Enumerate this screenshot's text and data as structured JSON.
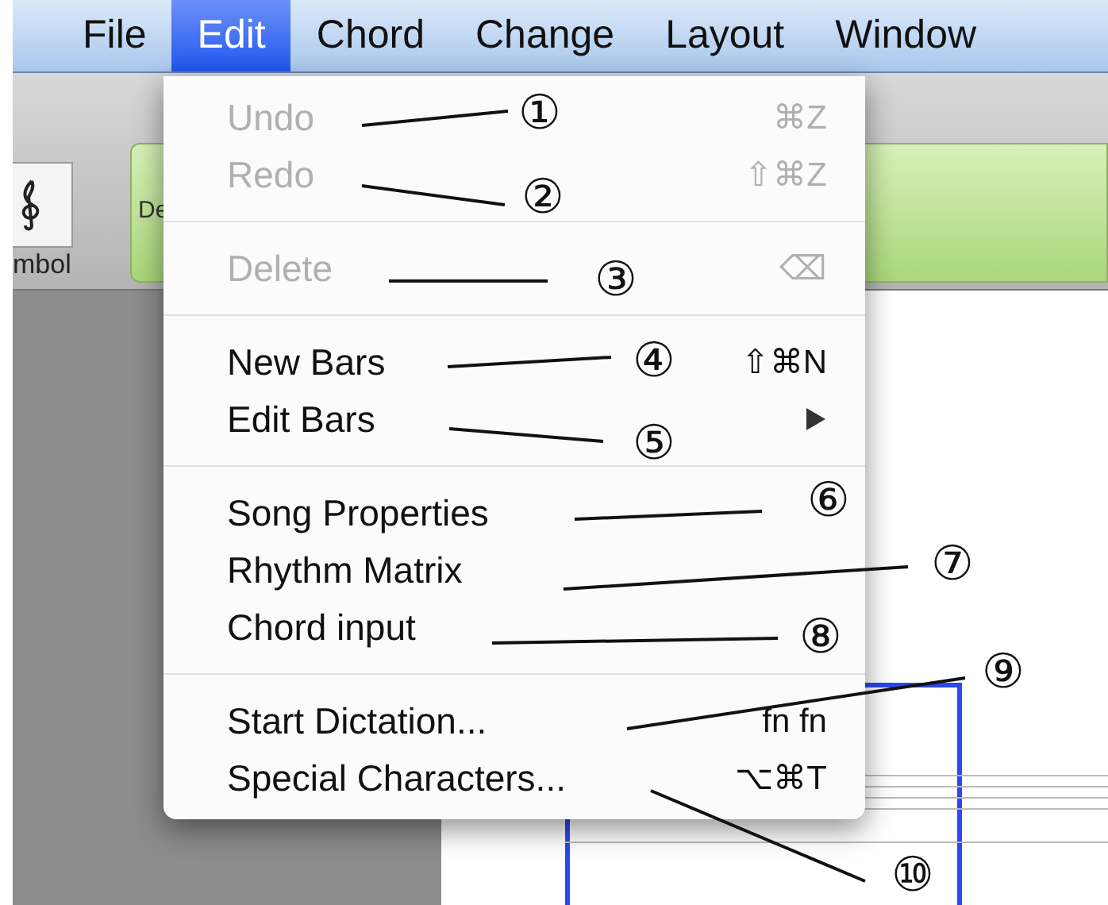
{
  "menu_bar": [
    {
      "label": "File",
      "selected": false
    },
    {
      "label": "Edit",
      "selected": true
    },
    {
      "label": "Chord",
      "selected": false
    },
    {
      "label": "Change",
      "selected": false
    },
    {
      "label": "Layout",
      "selected": false
    },
    {
      "label": "Window",
      "selected": false
    }
  ],
  "toolbar": {
    "symbol_button_label": "mbol",
    "panel_text": "De"
  },
  "menu": [
    {
      "kind": "item",
      "label": "Undo",
      "shortcut": "⌘Z",
      "disabled": true
    },
    {
      "kind": "item",
      "label": "Redo",
      "shortcut": "⇧⌘Z",
      "disabled": true
    },
    {
      "kind": "separator"
    },
    {
      "kind": "item",
      "label": "Delete",
      "shortcut": "⌫",
      "disabled": true
    },
    {
      "kind": "separator"
    },
    {
      "kind": "item",
      "label": "New Bars",
      "shortcut": "⇧⌘N",
      "disabled": false
    },
    {
      "kind": "submenu",
      "label": "Edit Bars",
      "disabled": false
    },
    {
      "kind": "separator"
    },
    {
      "kind": "item",
      "label": "Song Properties",
      "disabled": false
    },
    {
      "kind": "item",
      "label": "Rhythm Matrix",
      "disabled": false
    },
    {
      "kind": "item",
      "label": "Chord input",
      "disabled": false
    },
    {
      "kind": "separator"
    },
    {
      "kind": "item",
      "label": "Start Dictation...",
      "shortcut": "fn fn",
      "disabled": false
    },
    {
      "kind": "item",
      "label": "Special Characters...",
      "shortcut": "⌥⌘T",
      "disabled": false
    }
  ],
  "callouts": [
    {
      "label": "①"
    },
    {
      "label": "②"
    },
    {
      "label": "③"
    },
    {
      "label": "④"
    },
    {
      "label": "⑤"
    },
    {
      "label": "⑥"
    },
    {
      "label": "⑦"
    },
    {
      "label": "⑧"
    },
    {
      "label": "⑨"
    },
    {
      "label": "⑩"
    }
  ]
}
